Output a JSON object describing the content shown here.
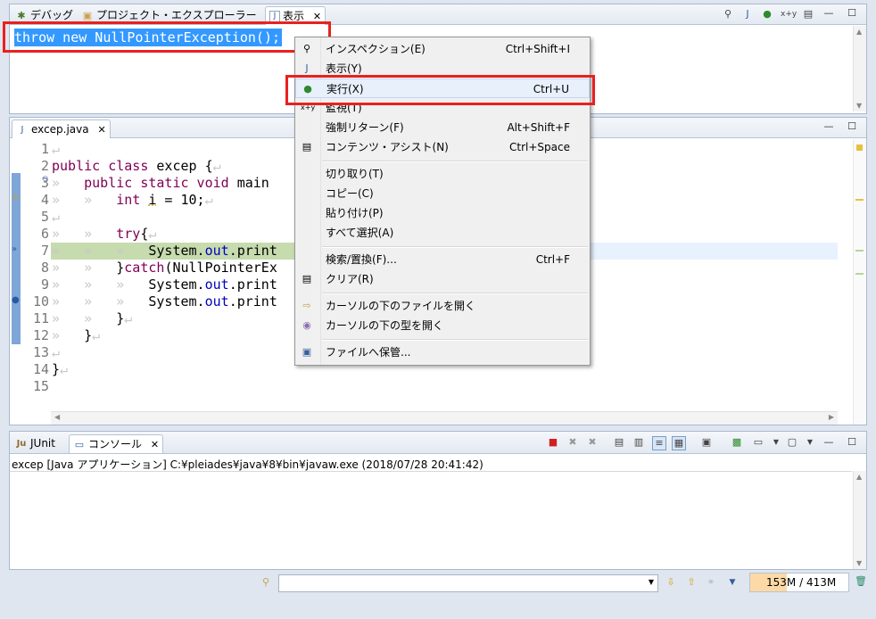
{
  "top_panel": {
    "tabs": [
      {
        "label": "デバッグ"
      },
      {
        "label": "プロジェクト・エクスプローラー"
      },
      {
        "label": "表示"
      }
    ],
    "expression": "throw new NullPointerException();"
  },
  "editor": {
    "tab_label": "excep.java",
    "lines": [
      {
        "n": "1"
      },
      {
        "n": "2"
      },
      {
        "n": "3"
      },
      {
        "n": "4"
      },
      {
        "n": "5"
      },
      {
        "n": "6"
      },
      {
        "n": "7"
      },
      {
        "n": "8"
      },
      {
        "n": "9"
      },
      {
        "n": "10"
      },
      {
        "n": "11"
      },
      {
        "n": "12"
      },
      {
        "n": "13"
      },
      {
        "n": "14"
      },
      {
        "n": "15"
      }
    ],
    "code": {
      "l2_kw": "public class",
      "l2_rest": " excep {",
      "l3_kw": "public static void",
      "l3_rest": " main",
      "l4_kw": "int",
      "l4_var": "i",
      "l4_rest": " = 10;",
      "l6_kw": "try",
      "l6_rest": "{",
      "l7_a": "System.",
      "l7_fld": "out",
      "l7_b": ".print",
      "l8_a": "}",
      "l8_kw": "catch",
      "l8_b": "(NullPointerEx",
      "l9_a": "System.",
      "l9_fld": "out",
      "l9_b": ".print",
      "l10_a": "System.",
      "l10_fld": "out",
      "l10_b": ".print",
      "l11": "}",
      "l12": "}",
      "l14": "}"
    }
  },
  "context_menu": {
    "items": [
      {
        "label": "インスペクション(E)",
        "shortcut": "Ctrl+Shift+I",
        "icon": "inspect-icon"
      },
      {
        "label": "表示(Y)",
        "shortcut": "",
        "icon": "display-icon"
      },
      {
        "label": "実行(X)",
        "shortcut": "Ctrl+U",
        "icon": "execute-icon"
      },
      {
        "label": "監視(T)",
        "shortcut": "",
        "icon": "watch-icon"
      },
      {
        "label": "強制リターン(F)",
        "shortcut": "Alt+Shift+F",
        "icon": ""
      },
      {
        "label": "コンテンツ・アシスト(N)",
        "shortcut": "Ctrl+Space",
        "icon": "content-assist-icon"
      },
      {
        "label": "切り取り(T)",
        "shortcut": "",
        "icon": ""
      },
      {
        "label": "コピー(C)",
        "shortcut": "",
        "icon": ""
      },
      {
        "label": "貼り付け(P)",
        "shortcut": "",
        "icon": ""
      },
      {
        "label": "すべて選択(A)",
        "shortcut": "",
        "icon": ""
      },
      {
        "label": "検索/置換(F)...",
        "shortcut": "Ctrl+F",
        "icon": ""
      },
      {
        "label": "クリア(R)",
        "shortcut": "",
        "icon": "clear-icon"
      },
      {
        "label": "カーソルの下のファイルを開く",
        "shortcut": "",
        "icon": "open-file-icon"
      },
      {
        "label": "カーソルの下の型を開く",
        "shortcut": "",
        "icon": "open-type-icon"
      },
      {
        "label": "ファイルへ保管...",
        "shortcut": "",
        "icon": "save-icon"
      }
    ]
  },
  "bottom_panel": {
    "tabs": [
      {
        "label": "JUnit"
      },
      {
        "label": "コンソール"
      }
    ],
    "console_header": "excep [Java アプリケーション] C:¥pleiades¥java¥8¥bin¥javaw.exe (2018/07/28 20:41:42)"
  },
  "status_bar": {
    "memory_used": "153M",
    "memory_total": "413M",
    "memory_fraction": 0.37
  },
  "colors": {
    "highlight_red": "#e8211f",
    "keyword": "#7f0055",
    "field": "#0000c0",
    "selection": "#3399ff",
    "current_line": "#c6dbae"
  }
}
